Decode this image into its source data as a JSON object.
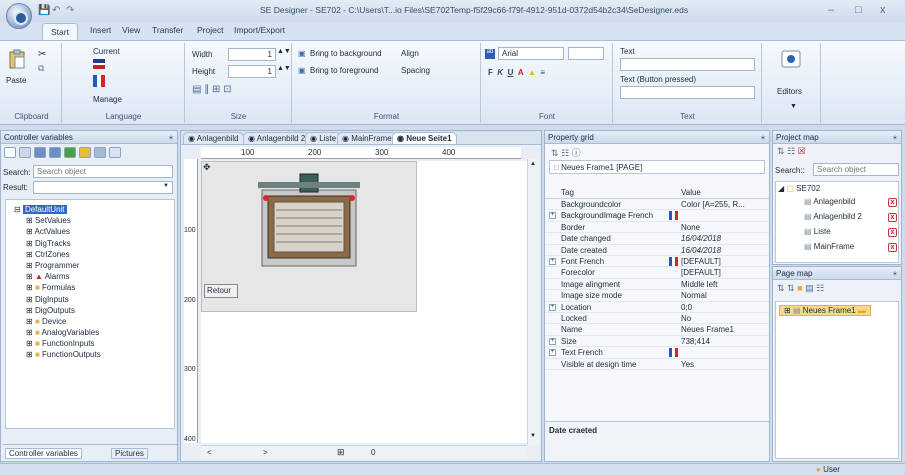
{
  "window": {
    "title": "SE Designer - SE702 - C:\\Users\\T...io Files\\SE702Temp-f5f29c66-f79f-4912-951d-0372d54b2c34\\SeDesigner.eds",
    "minimize": "–",
    "maximize": "□",
    "close": "x"
  },
  "ribbon_tabs": [
    "Start",
    "Insert",
    "View",
    "Transfer",
    "Project",
    "Import/Export"
  ],
  "ribbon": {
    "clipboard": {
      "label": "Clipboard",
      "paste": "Paste"
    },
    "language": {
      "label": "Language",
      "current": "Current",
      "manage": "Manage"
    },
    "size": {
      "label": "Size",
      "width_label": "Width",
      "width_value": "1",
      "height_label": "Height",
      "height_value": "1"
    },
    "format": {
      "label": "Format",
      "bring_background": "Bring to background",
      "bring_foreground": "Bring to foreground",
      "align": "Align",
      "spacing": "Spacing"
    },
    "font": {
      "label": "Font",
      "family": "Arial",
      "size": ""
    },
    "text": {
      "label": "Text",
      "text_label": "Text",
      "pressed_label": "Text (Button pressed)"
    },
    "editors": {
      "label": "Editors"
    }
  },
  "controller_panel": {
    "title": "Controller variables",
    "search_label": "Search:",
    "search_placeholder": "Search object",
    "result_label": "Result:",
    "tree": [
      "DefaultUnit",
      "SetValues",
      "ActValues",
      "DigTracks",
      "CtrlZones",
      "Programmer",
      "Alarms",
      "Formulas",
      "DigInputs",
      "DigOutputs",
      "Device",
      "AnalogVariables",
      "FunctionInputs",
      "FunctionOutputs"
    ],
    "bottom_tabs": [
      "Controller variables",
      "Pictures"
    ]
  },
  "doc_tabs": [
    "Anlagenbild",
    "Anlagenbild 2",
    "Liste",
    "MainFrame",
    "Neue Seite1"
  ],
  "canvas": {
    "ruler_h": [
      "100",
      "200",
      "300",
      "400"
    ],
    "ruler_v": [
      "100",
      "200",
      "300",
      "400"
    ],
    "button_label": "Retour",
    "footer_value": "0"
  },
  "property_grid": {
    "title": "Property grid",
    "object": "Neues Frame1 [PAGE]",
    "col_tag": "Tag",
    "col_value": "Value",
    "rows": [
      {
        "k": "Backgroundcolor",
        "v": "Color [A=255, R..."
      },
      {
        "k": "BackgroundImage French",
        "v": ""
      },
      {
        "k": "Border",
        "v": "None"
      },
      {
        "k": "Date changed",
        "v": "16/04/2018"
      },
      {
        "k": "Date created",
        "v": "16/04/2018"
      },
      {
        "k": "Font French",
        "v": "[DEFAULT]"
      },
      {
        "k": "Forecolor",
        "v": "[DEFAULT]"
      },
      {
        "k": "Image alingment",
        "v": "Middle left"
      },
      {
        "k": "Image size mode",
        "v": "Normal"
      },
      {
        "k": "Location",
        "v": "0;0"
      },
      {
        "k": "Locked",
        "v": "No"
      },
      {
        "k": "Name",
        "v": "Neues Frame1"
      },
      {
        "k": "Size",
        "v": "738;414"
      },
      {
        "k": "Text French",
        "v": ""
      },
      {
        "k": "Visible at design time",
        "v": "Yes"
      }
    ],
    "description": "Date craeted"
  },
  "project_map": {
    "title": "Project map",
    "search_label": "Search::",
    "search_placeholder": "Search object",
    "root": "SE702",
    "items": [
      "Anlagenbild",
      "Anlagenbild 2",
      "Liste",
      "MainFrame"
    ]
  },
  "page_map": {
    "title": "Page map",
    "item": "Neues Frame1"
  },
  "status": {
    "user": "User"
  }
}
